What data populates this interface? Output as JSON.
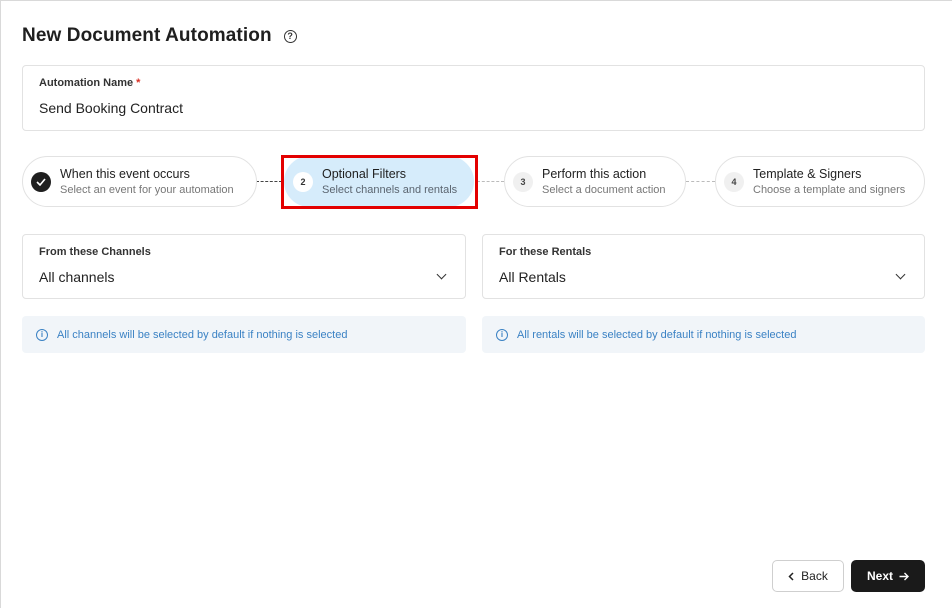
{
  "page": {
    "title": "New Document Automation",
    "help_icon": "question-circle-icon"
  },
  "automation_name": {
    "label": "Automation Name",
    "required_marker": "*",
    "value": "Send Booking Contract"
  },
  "steps": [
    {
      "number": "",
      "title": "When this event occurs",
      "subtitle": "Select an event for your automation",
      "status": "completed",
      "icon": "check-icon"
    },
    {
      "number": "2",
      "title": "Optional Filters",
      "subtitle": "Select channels and rentals",
      "status": "active"
    },
    {
      "number": "3",
      "title": "Perform this action",
      "subtitle": "Select a document action",
      "status": "pending"
    },
    {
      "number": "4",
      "title": "Template & Signers",
      "subtitle": "Choose a template and signers",
      "status": "pending"
    }
  ],
  "filters": {
    "channels": {
      "label": "From these Channels",
      "value": "All channels",
      "info": "All channels will be selected by default if nothing is selected"
    },
    "rentals": {
      "label": "For these Rentals",
      "value": "All Rentals",
      "info": "All rentals will be selected by default if nothing is selected"
    }
  },
  "actions": {
    "back_label": "Back",
    "next_label": "Next"
  },
  "colors": {
    "active_step_bg": "#d6ecfb",
    "highlight_border": "#e30000",
    "info_text": "#3b82c4",
    "primary_button": "#1a1a1a"
  }
}
